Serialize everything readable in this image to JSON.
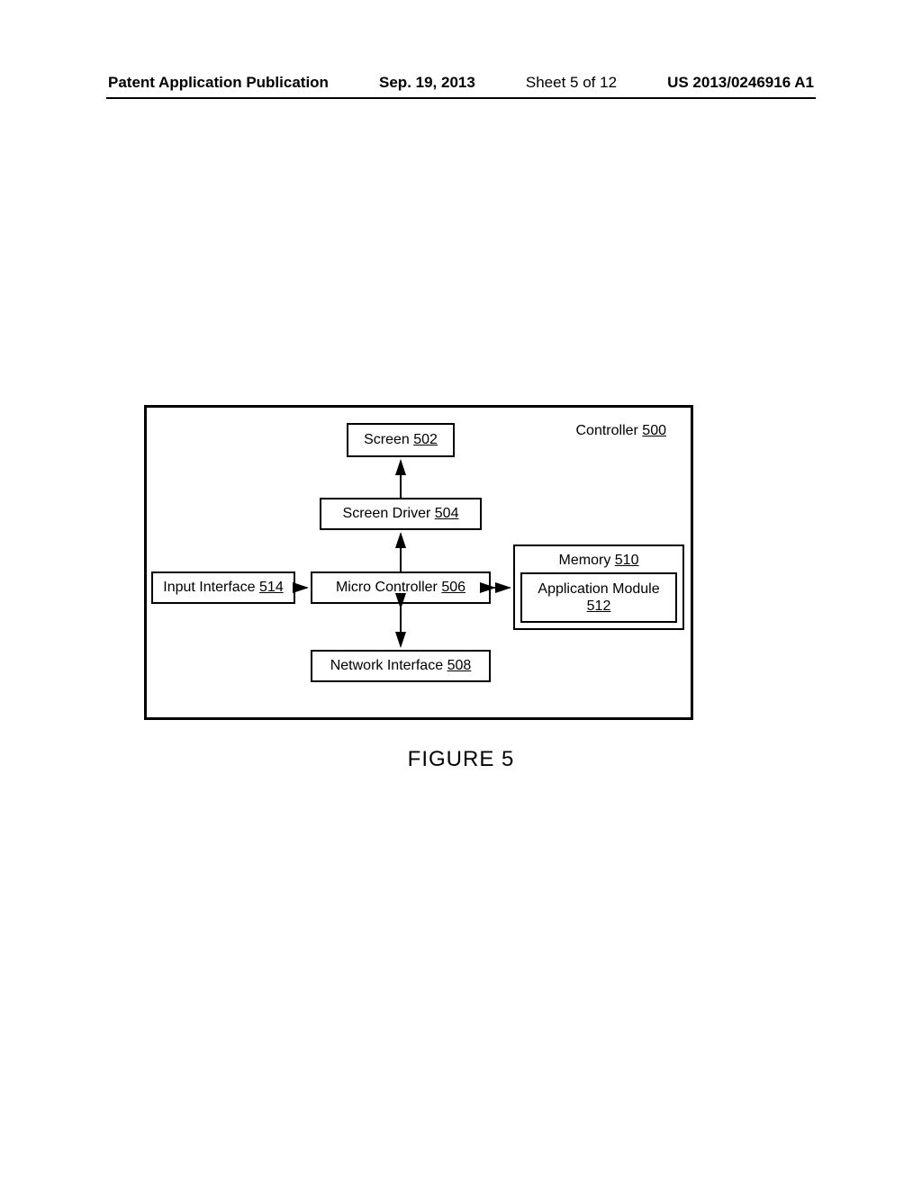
{
  "header": {
    "publication_label": "Patent Application Publication",
    "date": "Sep. 19, 2013",
    "sheet": "Sheet 5 of 12",
    "patent_number": "US 2013/0246916 A1"
  },
  "figure": {
    "caption": "FIGURE 5",
    "controller_label": "Controller",
    "controller_ref": "500",
    "blocks": {
      "screen": {
        "label": "Screen",
        "ref": "502"
      },
      "screen_driver": {
        "label": "Screen Driver",
        "ref": "504"
      },
      "micro_controller": {
        "label": "Micro Controller",
        "ref": "506"
      },
      "network_interface": {
        "label": "Network Interface",
        "ref": "508"
      },
      "memory": {
        "label": "Memory",
        "ref": "510"
      },
      "application_module": {
        "label": "Application Module",
        "ref": "512"
      },
      "input_interface": {
        "label": "Input Interface",
        "ref": "514"
      }
    }
  },
  "chart_data": {
    "type": "block-diagram",
    "title": "FIGURE 5",
    "container": {
      "id": "500",
      "label": "Controller"
    },
    "nodes": [
      {
        "id": "502",
        "label": "Screen"
      },
      {
        "id": "504",
        "label": "Screen Driver"
      },
      {
        "id": "506",
        "label": "Micro Controller"
      },
      {
        "id": "508",
        "label": "Network Interface"
      },
      {
        "id": "510",
        "label": "Memory"
      },
      {
        "id": "512",
        "label": "Application Module",
        "parent": "510"
      },
      {
        "id": "514",
        "label": "Input Interface"
      }
    ],
    "edges": [
      {
        "from": "504",
        "to": "502",
        "direction": "uni"
      },
      {
        "from": "506",
        "to": "504",
        "direction": "uni"
      },
      {
        "from": "506",
        "to": "508",
        "direction": "bi"
      },
      {
        "from": "514",
        "to": "506",
        "direction": "uni"
      },
      {
        "from": "506",
        "to": "510",
        "direction": "bi"
      }
    ]
  }
}
